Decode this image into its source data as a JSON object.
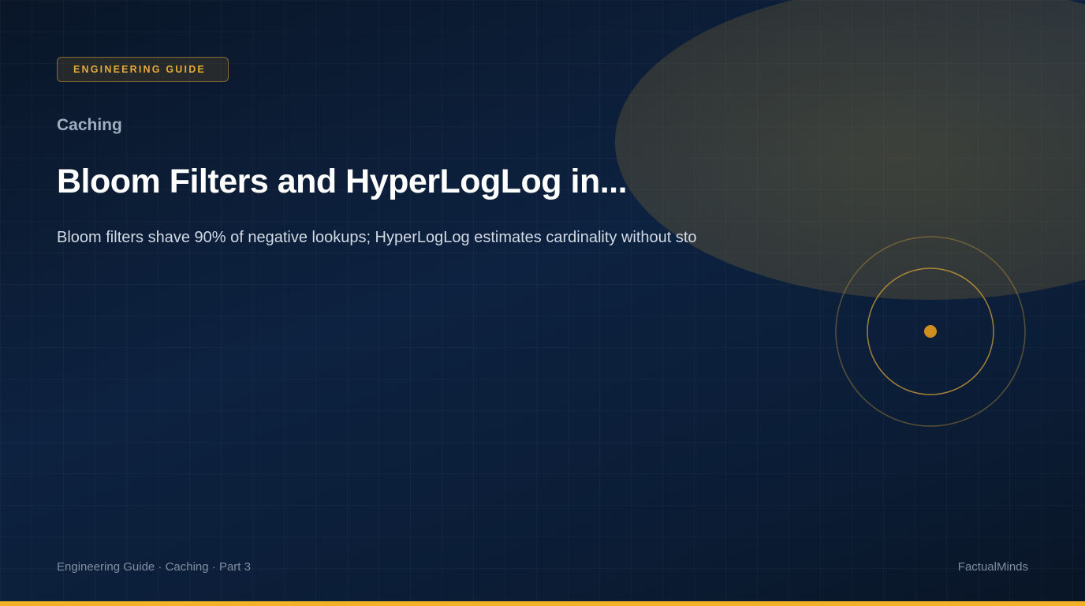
{
  "badge": {
    "label": "ENGINEERING GUIDE"
  },
  "category": "Caching",
  "title": "Bloom Filters and HyperLogLog in...",
  "subtitle": "Bloom filters shave 90% of negative lookups; HyperLogLog estimates cardinality without sto",
  "footer": {
    "left": "Engineering Guide · Caching · Part 3",
    "right": "FactualMinds"
  },
  "colors": {
    "accent": "#f2b126",
    "badge_text": "#e7a93c",
    "background": "#0d2240",
    "title": "#ffffff"
  }
}
